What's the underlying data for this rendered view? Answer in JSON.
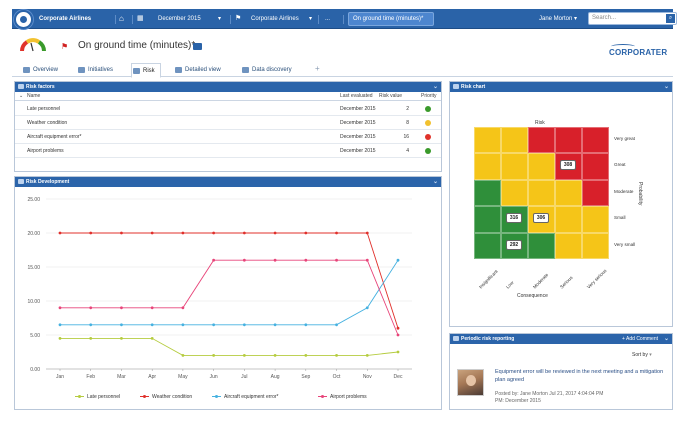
{
  "topbar": {
    "app_name": "Corporate Airlines",
    "crumbs": [
      "December 2015",
      "Corporate Airlines",
      "..."
    ],
    "active_crumb": "On ground time (minutes)*",
    "user": "Jane Morton",
    "search_placeholder": "Search..."
  },
  "header": {
    "title": "On ground time (minutes)*",
    "brand": "CORPORATER"
  },
  "tabs": [
    {
      "label": "Overview"
    },
    {
      "label": "Initiatives"
    },
    {
      "label": "Risk"
    },
    {
      "label": "Detailed view"
    },
    {
      "label": "Data discovery"
    }
  ],
  "risk_factors": {
    "title": "Risk factors",
    "columns": {
      "name": "Name",
      "last_evaluated": "Last evaluated",
      "risk_value": "Risk value",
      "priority": "Priority"
    },
    "rows": [
      {
        "name": "Late personnel",
        "last_evaluated": "December 2015",
        "risk_value": "2",
        "priority_color": "#3a9a2b"
      },
      {
        "name": "Weather condition",
        "last_evaluated": "December 2015",
        "risk_value": "8",
        "priority_color": "#f2c12e"
      },
      {
        "name": "Aircraft equipment error*",
        "last_evaluated": "December 2015",
        "risk_value": "16",
        "priority_color": "#e0332b"
      },
      {
        "name": "Airport problems",
        "last_evaluated": "December 2015",
        "risk_value": "4",
        "priority_color": "#3a9a2b"
      }
    ]
  },
  "risk_development": {
    "title": "Risk Development"
  },
  "chart_data": {
    "type": "line",
    "categories": [
      "Jan",
      "Feb",
      "Mar",
      "Apr",
      "May",
      "Jun",
      "Jul",
      "Aug",
      "Sep",
      "Oct",
      "Nov",
      "Dec"
    ],
    "ylim": [
      0,
      25
    ],
    "yticks": [
      "25.00",
      "20.00",
      "15.00",
      "10.00",
      "5.00",
      "0.00"
    ],
    "series": [
      {
        "name": "Late personnel",
        "color": "#b5cc3f",
        "values": [
          4.5,
          4.5,
          4.5,
          4.5,
          2,
          2,
          2,
          2,
          2,
          2,
          2,
          2.5
        ]
      },
      {
        "name": "Weather condition",
        "color": "#e0302b",
        "values": [
          20,
          20,
          20,
          20,
          20,
          20,
          20,
          20,
          20,
          20,
          20,
          6
        ]
      },
      {
        "name": "Aircraft equipment error*",
        "color": "#45b1e0",
        "values": [
          6.5,
          6.5,
          6.5,
          6.5,
          6.5,
          6.5,
          6.5,
          6.5,
          6.5,
          6.5,
          9,
          16
        ]
      },
      {
        "name": "Airport problems",
        "color": "#e8457a",
        "values": [
          9,
          9,
          9,
          9,
          9,
          16,
          16,
          16,
          16,
          16,
          16,
          5
        ]
      }
    ],
    "legend": "bottom"
  },
  "risk_chart": {
    "title": "Risk chart",
    "top_label": "Risk",
    "x_label": "Consequence",
    "y_label": "Probability",
    "x_categories": [
      "Insignificant",
      "Low",
      "Moderate",
      "Serious",
      "Very serious"
    ],
    "y_categories": [
      "Very great",
      "Great",
      "Moderate",
      "Small",
      "Very small"
    ],
    "colors": {
      "green": "#2f8f3a",
      "yellow": "#f5c518",
      "red": "#d8202a"
    },
    "grid": [
      [
        "yellow",
        "yellow",
        "red",
        "red",
        "red"
      ],
      [
        "yellow",
        "yellow",
        "yellow",
        "red",
        "red"
      ],
      [
        "green",
        "yellow",
        "yellow",
        "yellow",
        "red"
      ],
      [
        "green",
        "green",
        "yellow",
        "yellow",
        "yellow"
      ],
      [
        "green",
        "green",
        "green",
        "yellow",
        "yellow"
      ]
    ],
    "markers": [
      {
        "label": "308",
        "row": 1,
        "col": 3
      },
      {
        "label": "316",
        "row": 3,
        "col": 1
      },
      {
        "label": "306",
        "row": 3,
        "col": 2
      },
      {
        "label": "292",
        "row": 4,
        "col": 1
      }
    ]
  },
  "comments": {
    "title": "Periodic risk reporting",
    "add_label": "+ Add Comment",
    "sort_label": "Sort by",
    "text": "Equipment error will be reviewed in the next meeting and a mitigation plan agreed",
    "posted_by": "Posted by: Jane Morton  Jul 21, 2017 4:04:04 PM",
    "period": "PM: December 2015"
  }
}
